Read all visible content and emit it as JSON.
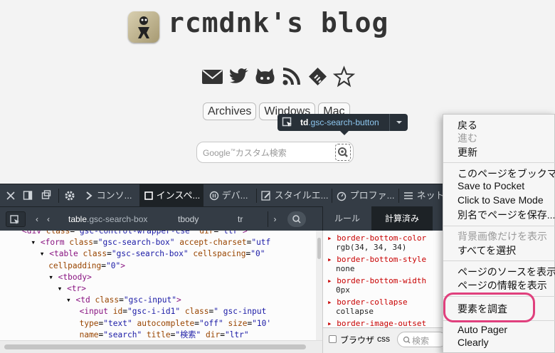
{
  "blog": {
    "title": "rcmdnk's blog",
    "social_icons": [
      "mail-icon",
      "twitter-icon",
      "github-icon",
      "rss-icon",
      "feedly-icon",
      "star-icon"
    ],
    "tabs": [
      "Archives",
      "Windows",
      "Mac"
    ],
    "search": {
      "placeholder_brand": "Google",
      "placeholder_tm": "™",
      "placeholder_text": "カスタム検索"
    },
    "tooltip": {
      "element": "td",
      "class_part": ".gsc-search-button"
    }
  },
  "devtools": {
    "toolbar": {
      "console": "コンソ...",
      "inspector": "インスペ...",
      "debugger": "デバ...",
      "style_editor": "スタイルエ...",
      "profiler": "プロファ...",
      "network": "ネット"
    },
    "breadcrumbs": [
      {
        "tag": "table",
        "cls": ".gsc-search-box"
      },
      {
        "tag": "tbody",
        "cls": ""
      },
      {
        "tag": "tr",
        "cls": ""
      }
    ],
    "side_tabs": {
      "rules": "ルール",
      "computed": "計算済み"
    },
    "computed_props": [
      {
        "name": "border-bottom-color",
        "value": "rgb(34, 34, 34)"
      },
      {
        "name": "border-bottom-style",
        "value": "none"
      },
      {
        "name": "border-bottom-width",
        "value": "0px"
      },
      {
        "name": "border-collapse",
        "value": "collapse"
      },
      {
        "name": "border-image-outset",
        "value": ""
      }
    ],
    "browser_css": {
      "label": "ブラウザ",
      "css": "css",
      "search_placeholder": "検索"
    },
    "html_lines": [
      {
        "indent": 5,
        "html": "<span class='t'>&lt;div</span> <span class='a'>class</span>=<span class='v'>\"gsc-control-wrapper-cse\"</span> <span class='a'>dir</span>=<span class='v'>\"ltr\"</span><span class='t'>&gt;</span>"
      },
      {
        "indent": 7,
        "html": "▾ <span class='t'>&lt;form</span> <span class='a'>class</span>=<span class='v'>\"gsc-search-box\"</span> <span class='a'>accept-charset</span>=<span class='v'>\"utf</span>"
      },
      {
        "indent": 9,
        "html": "▾ <span class='t'>&lt;table</span> <span class='a'>class</span>=<span class='v'>\"gsc-search-box\"</span> <span class='a'>cellspacing</span>=<span class='v'>\"0\"</span>"
      },
      {
        "indent": 11,
        "html": "<span class='a'>cellpadding</span>=<span class='v'>\"0\"</span><span class='t'>&gt;</span>"
      },
      {
        "indent": 11,
        "html": "▾ <span class='t'>&lt;tbody&gt;</span>"
      },
      {
        "indent": 13,
        "html": "▾ <span class='t'>&lt;tr&gt;</span>"
      },
      {
        "indent": 15,
        "html": "▾ <span class='t'>&lt;td</span> <span class='a'>class</span>=<span class='v'>\"gsc-input\"</span><span class='t'>&gt;</span>"
      },
      {
        "indent": 18,
        "html": "<span class='t'>&lt;input</span> <span class='a'>id</span>=<span class='v'>\"gsc-i-id1\"</span> <span class='a'>class</span>=<span class='v'>\" gsc-input</span>"
      },
      {
        "indent": 18,
        "html": "<span class='a'>type</span>=<span class='v'>\"text\"</span> <span class='a'>autocomplete</span>=<span class='v'>\"off\"</span> <span class='a'>size</span>=<span class='v'>\"10'</span>"
      },
      {
        "indent": 18,
        "html": "<span class='a'>name</span>=<span class='v'>\"search\"</span> <span class='a'>title</span>=<span class='v'>\"検索\"</span> <span class='a'>dir</span>=<span class='v'>\"ltr\"</span>"
      }
    ]
  },
  "context_menu": {
    "back": "戻る",
    "forward": "進む",
    "reload": "更新",
    "bookmark": "このページをブックマ",
    "save_pocket": "Save to Pocket",
    "click_save": "Click to Save Mode",
    "save_as": "別名でページを保存...",
    "bg_image": "背景画像だけを表示",
    "select_all": "すべてを選択",
    "view_source": "ページのソースを表示",
    "page_info": "ページの情報を表示",
    "inspect": "要素を調査",
    "auto_pager": "Auto Pager",
    "clearly": "Clearly"
  },
  "colors": {
    "highlight": "#e0407d",
    "devtools_bg": "#343c45",
    "selected_bg": "#1d2226"
  }
}
